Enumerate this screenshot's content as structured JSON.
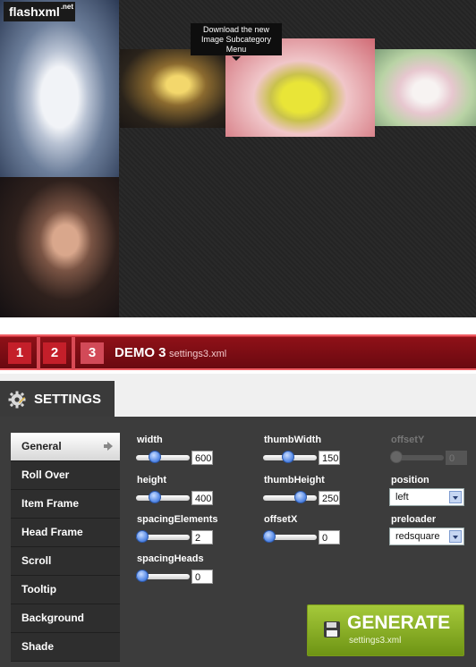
{
  "logo": {
    "name": "flashxml",
    "suffix": ".net"
  },
  "preview": {
    "tooltip": "Download the new\nImage Subcategory\nMenu",
    "thumbs": [
      "bride-photo",
      "couple-photo",
      "blonde-chair-photo",
      "yellow-dress-photo",
      "blossom-photo"
    ]
  },
  "demo": {
    "tabs": [
      "1",
      "2",
      "3"
    ],
    "active_tab": "3",
    "title": "DEMO 3",
    "file": "settings3.xml"
  },
  "settings": {
    "title": "SETTINGS",
    "menu": [
      "General",
      "Roll Over",
      "Item Frame",
      "Head Frame",
      "Scroll",
      "Tooltip",
      "Background",
      "Shade"
    ],
    "active_menu": "General",
    "fields": {
      "width": {
        "label": "width",
        "value": "600",
        "level": 0.3
      },
      "height": {
        "label": "height",
        "value": "400",
        "level": 0.3
      },
      "spacingElements": {
        "label": "spacingElements",
        "value": "2",
        "level": 0.0
      },
      "spacingHeads": {
        "label": "spacingHeads",
        "value": "0",
        "level": 0.0
      },
      "thumbWidth": {
        "label": "thumbWidth",
        "value": "150",
        "level": 0.45
      },
      "thumbHeight": {
        "label": "thumbHeight",
        "value": "250",
        "level": 0.75
      },
      "offsetX": {
        "label": "offsetX",
        "value": "0",
        "level": 0.0
      },
      "offsetY": {
        "label": "offsetY",
        "value": "0",
        "level": 0.0,
        "disabled": true
      },
      "position": {
        "label": "position",
        "value": "left"
      },
      "preloader": {
        "label": "preloader",
        "value": "redsquare"
      }
    },
    "generate": {
      "label": "GENERATE",
      "file": "settings3.xml"
    }
  },
  "colors": {
    "accent_red": "#8f1118",
    "generate_green": "#8cb22a",
    "panel_bg": "#3c3c3c"
  }
}
